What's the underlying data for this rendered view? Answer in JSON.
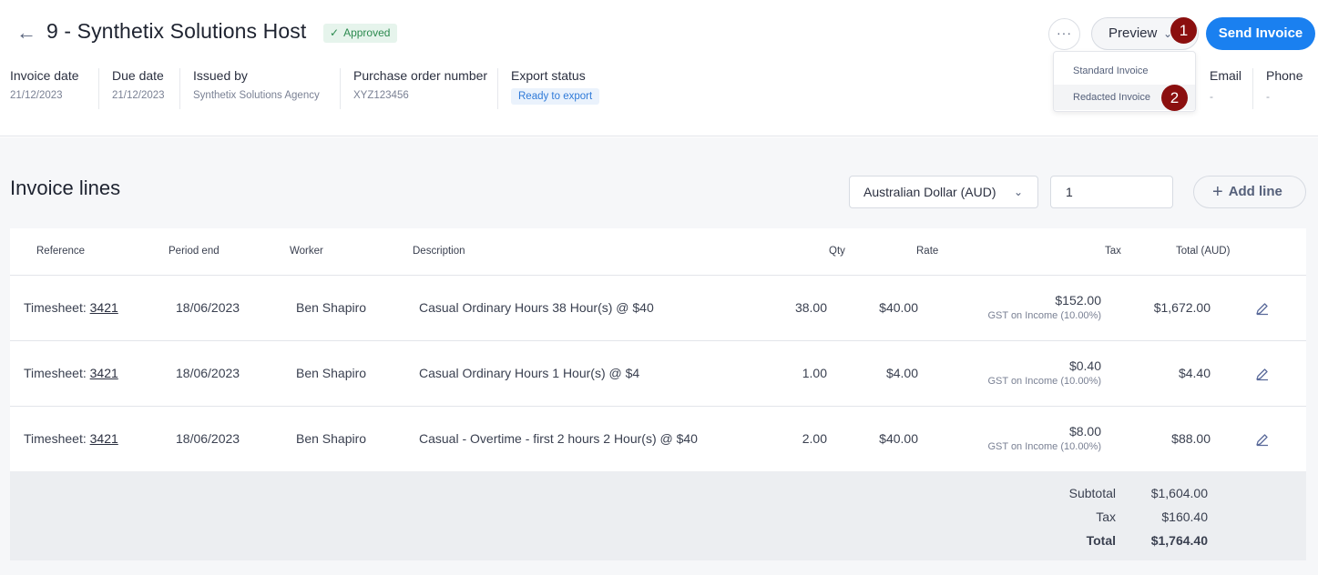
{
  "header": {
    "back_icon": "arrow-left-icon",
    "title": "9 - Synthetix Solutions Host",
    "status_badge": "Approved",
    "more_label": "···",
    "preview_label": "Preview",
    "send_label": "Send Invoice",
    "preview_menu": [
      "Standard Invoice",
      "Redacted Invoice"
    ],
    "step_badges": [
      "1",
      "2"
    ],
    "step_badge_color": "#8b0f0f",
    "accent_color": "#1a80f0"
  },
  "meta": [
    {
      "label": "Invoice date",
      "value": "21/12/2023"
    },
    {
      "label": "Due date",
      "value": "21/12/2023"
    },
    {
      "label": "Issued by",
      "value": "Synthetix Solutions Agency"
    },
    {
      "label": "Purchase order number",
      "value": "XYZ123456"
    },
    {
      "label": "Export status",
      "value": "Ready to export"
    }
  ],
  "contact": [
    {
      "label": "Email",
      "value": "-"
    },
    {
      "label": "Phone",
      "value": "-"
    }
  ],
  "invoice_lines": {
    "title": "Invoice lines",
    "currency": "Australian Dollar (AUD)",
    "exchange_rate": "1",
    "add_line_label": "Add line",
    "columns": [
      "Reference",
      "Period end",
      "Worker",
      "Description",
      "Qty",
      "Rate",
      "Tax",
      "Total (AUD)"
    ],
    "rows": [
      {
        "ref_prefix": "Timesheet: ",
        "ref_link": "3421",
        "period_end": "18/06/2023",
        "worker": "Ben Shapiro",
        "description": "Casual Ordinary Hours 38 Hour(s) @ $40",
        "qty": "38.00",
        "rate": "$40.00",
        "tax": "$152.00",
        "tax_desc": "GST on Income (10.00%)",
        "total": "$1,672.00"
      },
      {
        "ref_prefix": "Timesheet: ",
        "ref_link": "3421",
        "period_end": "18/06/2023",
        "worker": "Ben Shapiro",
        "description": "Casual Ordinary Hours 1 Hour(s) @ $4",
        "qty": "1.00",
        "rate": "$4.00",
        "tax": "$0.40",
        "tax_desc": "GST on Income (10.00%)",
        "total": "$4.40"
      },
      {
        "ref_prefix": "Timesheet: ",
        "ref_link": "3421",
        "period_end": "18/06/2023",
        "worker": "Ben Shapiro",
        "description": "Casual - Overtime - first 2 hours 2 Hour(s) @ $40",
        "qty": "2.00",
        "rate": "$40.00",
        "tax": "$8.00",
        "tax_desc": "GST on Income (10.00%)",
        "total": "$88.00"
      }
    ],
    "totals": {
      "subtotal_label": "Subtotal",
      "subtotal": "$1,604.00",
      "tax_label": "Tax",
      "tax": "$160.40",
      "total_label": "Total",
      "total": "$1,764.40"
    }
  }
}
